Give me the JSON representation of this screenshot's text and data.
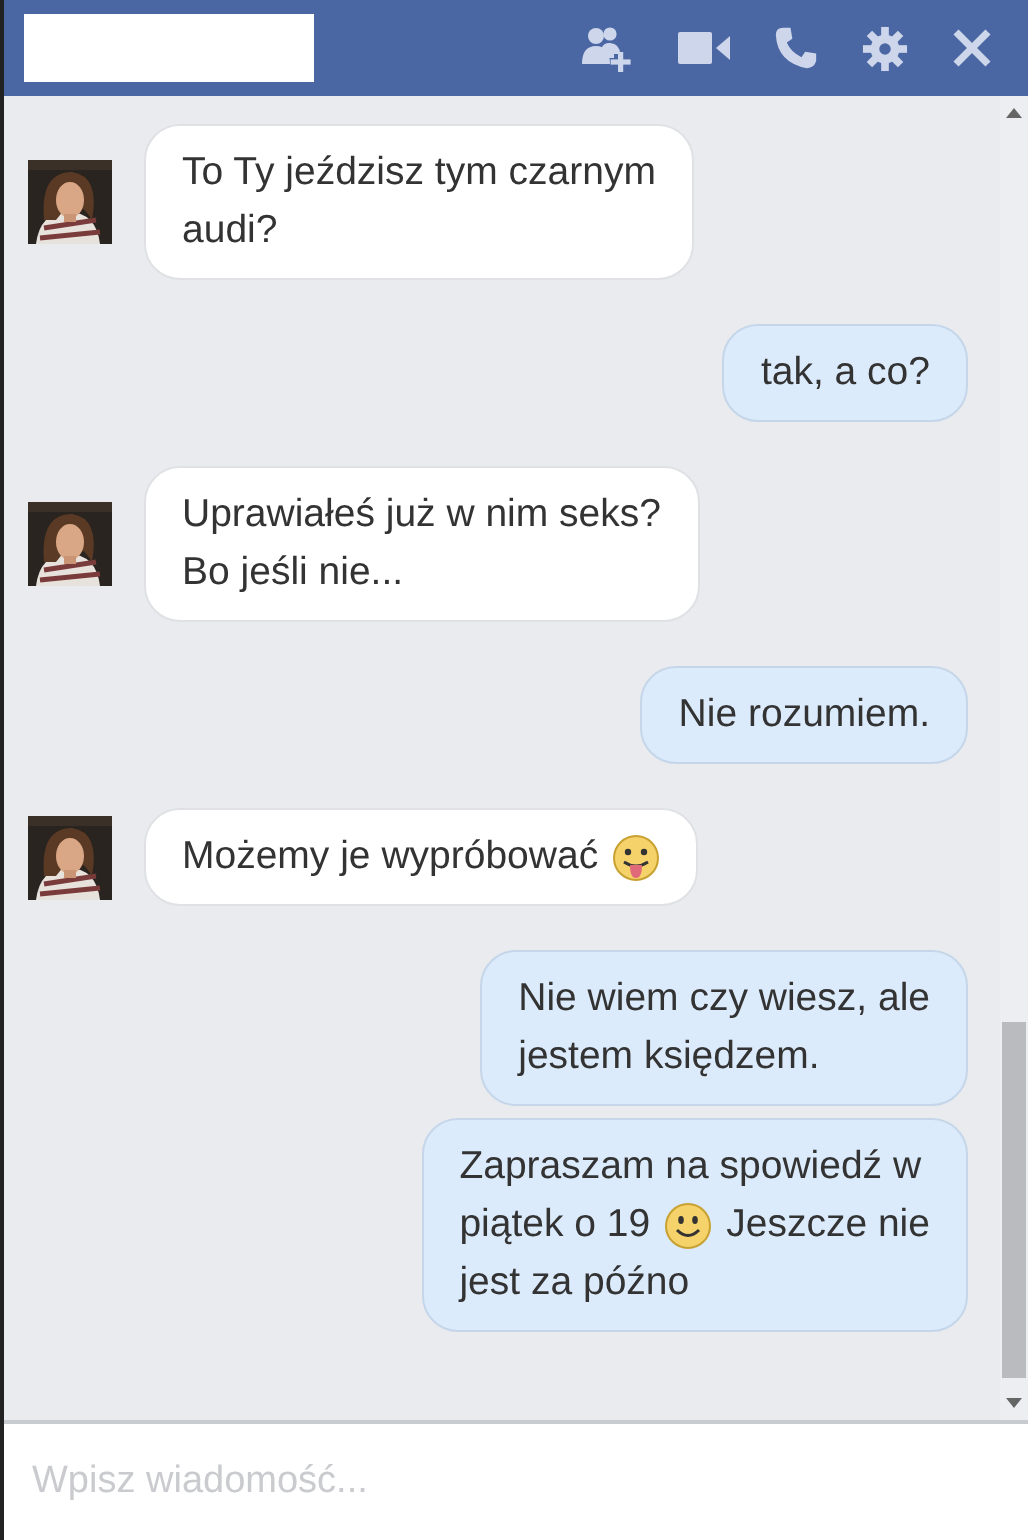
{
  "header": {
    "actions": [
      {
        "kind": "add-person"
      },
      {
        "kind": "video"
      },
      {
        "kind": "phone"
      },
      {
        "kind": "settings"
      },
      {
        "kind": "close"
      }
    ]
  },
  "messages": [
    {
      "kind": "received",
      "lines": [
        [
          {
            "text": "To Ty jeździsz tym czarnym"
          }
        ],
        [
          {
            "text": "audi?"
          }
        ]
      ]
    },
    {
      "kind": "sent",
      "lines": [
        [
          {
            "text": "tak, a co?"
          }
        ]
      ]
    },
    {
      "kind": "received",
      "lines": [
        [
          {
            "text": "Uprawiałeś już w nim seks?"
          }
        ],
        [
          {
            "text": "Bo jeśli nie..."
          }
        ]
      ]
    },
    {
      "kind": "sent",
      "lines": [
        [
          {
            "text": "Nie rozumiem."
          }
        ]
      ]
    },
    {
      "kind": "received",
      "lines": [
        [
          {
            "text": "Możemy je wypróbować"
          },
          {
            "kind": "tongue"
          }
        ]
      ]
    },
    {
      "kind": "sent",
      "lines": [
        [
          {
            "text": "Nie wiem czy wiesz, ale"
          }
        ],
        [
          {
            "text": "jestem księdzem."
          }
        ]
      ]
    },
    {
      "kind": "sent",
      "lines": [
        [
          {
            "text": "Zapraszam na spowiedź w"
          }
        ],
        [
          {
            "text": "piątek o 19"
          },
          {
            "kind": "smile"
          },
          {
            "text": "Jeszcze nie"
          }
        ],
        [
          {
            "text": "jest za późno"
          }
        ]
      ]
    }
  ],
  "composer": {
    "placeholder": "Wpisz wiadomość..."
  }
}
